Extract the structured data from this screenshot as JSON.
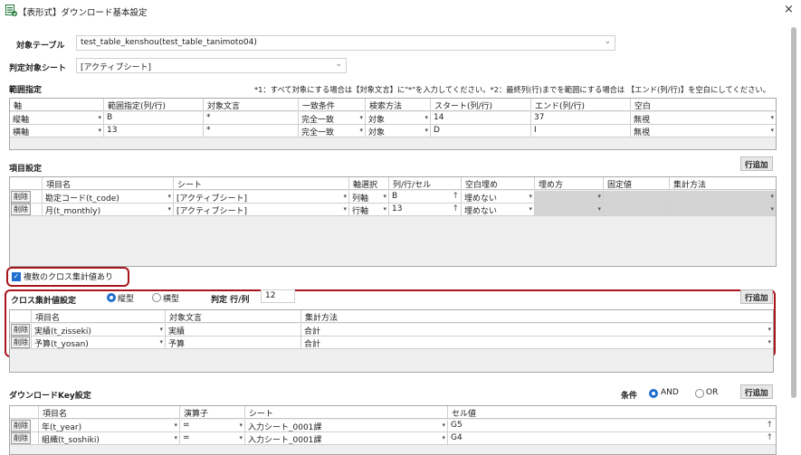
{
  "window": {
    "title": "【表形式】ダウンロード基本設定",
    "close": "×"
  },
  "target_table": {
    "label": "対象テーブル",
    "value": "test_table_kenshou(test_table_tanimoto04)"
  },
  "judge_sheet": {
    "label": "判定対象シート",
    "value": "[アクティブシート]"
  },
  "range": {
    "label": "範囲指定",
    "note": "*1：すべて対象にする場合は【対象文言】に\"*\"を入力してください。*2：最終列(行)までを範囲にする場合は 【エンド(列/行)】を空白にしてください。",
    "headers": [
      "軸",
      "範囲指定(列/行)",
      "対象文言",
      "一致条件",
      "検索方法",
      "スタート(列/行)",
      "エンド(列/行)",
      "空白"
    ],
    "rows": [
      [
        "縦軸",
        "B",
        "*",
        "完全一致",
        "対象",
        "14",
        "37",
        "無視"
      ],
      [
        "横軸",
        "13",
        "*",
        "完全一致",
        "対象",
        "D",
        "I",
        "無視"
      ]
    ]
  },
  "item": {
    "label": "項目設定",
    "add": "行追加",
    "delete": "削除",
    "headers": [
      "項目名",
      "シート",
      "軸選択",
      "列/行/セル",
      "空白埋め",
      "埋め方",
      "固定値",
      "集計方法"
    ],
    "rows": [
      [
        "勘定コード(t_code)",
        "[アクティブシート]",
        "列軸",
        "B",
        "埋めない",
        "",
        "",
        ""
      ],
      [
        "月(t_monthly)",
        "[アクティブシート]",
        "行軸",
        "13",
        "埋めない",
        "",
        "",
        ""
      ]
    ],
    "arrow": "↑"
  },
  "multi_cross": {
    "label": "複数のクロス集計値あり",
    "checked": true,
    "check": "✓"
  },
  "cross": {
    "label": "クロス集計値設定",
    "radio_vertical": "縦型",
    "radio_horizontal": "横型",
    "judge_label": "判定 行/列",
    "judge_value": "12",
    "add": "行追加",
    "delete": "削除",
    "headers": [
      "項目名",
      "対象文言",
      "集計方法"
    ],
    "rows": [
      [
        "実績(t_zisseki)",
        "実績",
        "合計"
      ],
      [
        "予算(t_yosan)",
        "予算",
        "合計"
      ]
    ]
  },
  "download_key": {
    "label": "ダウンロードKey設定",
    "condition_label": "条件",
    "and": "AND",
    "or": "OR",
    "add": "行追加",
    "delete": "削除",
    "headers": [
      "項目名",
      "演算子",
      "シート",
      "セル値"
    ],
    "rows": [
      [
        "年(t_year)",
        "=",
        "入力シート_0001課",
        "G5"
      ],
      [
        "組織(t_soshiki)",
        "=",
        "入力シート_0001課",
        "G4"
      ]
    ],
    "arrow": "↑"
  },
  "icons": {
    "dropdown": "▾",
    "chevron": "⌄"
  },
  "colors": {
    "accent": "#1e6fd0",
    "highlight_box": "#a8151c"
  }
}
